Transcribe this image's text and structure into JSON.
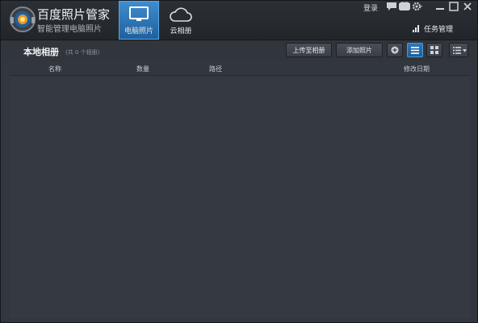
{
  "app": {
    "name": "百度照片管家",
    "subtitle": "智能管理电脑照片"
  },
  "nav_tabs": [
    {
      "label": "电脑照片",
      "icon": "monitor-icon",
      "active": true
    },
    {
      "label": "云相册",
      "icon": "cloud-icon",
      "active": false
    }
  ],
  "top_bar": {
    "login_label": "登录",
    "task_manager_label": "任务管理"
  },
  "toolbar": {
    "album_title": "本地相册",
    "album_count": "(共 0 个相册)",
    "upload_label": "上传至相册",
    "add_photos_label": "添加照片"
  },
  "columns": {
    "name": "名称",
    "count": "数量",
    "path": "路径",
    "modified": "修改日期"
  },
  "colors": {
    "accent": "#2e78b8",
    "background": "#32363e"
  }
}
